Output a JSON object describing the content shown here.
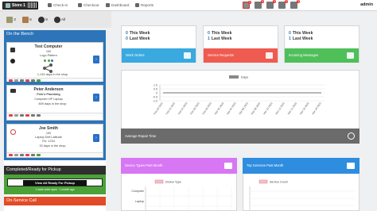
{
  "topbar": {
    "store_label": "Store 1",
    "nav": [
      {
        "label": "Check-in",
        "icon": "check-in-icon"
      },
      {
        "label": "Checkout",
        "icon": "cart-icon"
      },
      {
        "label": "Dashboard",
        "icon": "dashboard-icon"
      },
      {
        "label": "Reports",
        "icon": "reports-icon"
      }
    ],
    "icon_badges": [
      "2",
      "9",
      "4",
      "5",
      "3"
    ],
    "user": "admin"
  },
  "subbar": {
    "items": [
      {
        "icon": "tickets-icon",
        "count": "3"
      },
      {
        "icon": "users-icon",
        "count": "6"
      },
      {
        "icon": "clock-icon",
        "count": "9"
      },
      {
        "icon": "timer-icon",
        "count": "All"
      }
    ]
  },
  "bench": {
    "title": "On the Bench",
    "cards": [
      {
        "name": "Test Computer",
        "line1": "100",
        "line2": "Logo Pattern",
        "days": "1,133 days in the shop"
      },
      {
        "name": "Peter Anderson",
        "line1": "Pete's Plumbing",
        "line2": "Computer HP Laptop",
        "days": "809 days in the shop"
      },
      {
        "name": "Joe Smith",
        "line1": "100",
        "line2": "Laptop Dell Latitude",
        "line3": "Fix: 1234",
        "days": "32 days in the shop"
      }
    ]
  },
  "ready": {
    "title": "Completed/Ready for Pickup",
    "button": "View All Ready For Pickup",
    "sub": "1 work order open · 1 month ago"
  },
  "service_call": {
    "title": "On-Service Call"
  },
  "stats": [
    {
      "this_week": "0",
      "last_week": "0",
      "this_label": "This Week",
      "last_label": "Last Week"
    },
    {
      "this_week": "0",
      "last_week": "1",
      "this_label": "This Week",
      "last_label": "Last Week"
    },
    {
      "this_week": "0",
      "last_week": "1",
      "this_label": "This Week",
      "last_label": "Last Week"
    }
  ],
  "tiles": [
    {
      "label": "Work Orders",
      "color": "#39a9e0",
      "icon": "wrench-icon"
    },
    {
      "label": "Service Requests",
      "color": "#ef5b50",
      "icon": "chat-icon"
    },
    {
      "label": "Incoming Messages",
      "color": "#4fbf5a",
      "icon": "phone-icon"
    }
  ],
  "repair": {
    "label": "Average Repair Time",
    "icon": "clock-icon"
  },
  "device_types": {
    "label": "Device Types Past Month",
    "icon": "monitor-icon"
  },
  "top_services": {
    "label": "Top Services Past Month",
    "icon": "toolbox-icon"
  },
  "chart_data": [
    {
      "type": "line",
      "title": "",
      "legend": [
        "Days"
      ],
      "yticks": [
        "1.0",
        "0.5",
        "0",
        "-0.5",
        "-1.0"
      ],
      "ylim": [
        -1.0,
        1.0
      ],
      "x": [
        "Feb 20 2023",
        "Feb 22 2023",
        "Feb 24 2023",
        "Feb 26 2023",
        "Feb 28 2023",
        "Mar 02 2023",
        "Mar 04 2023",
        "Mar 06 2023",
        "Mar 08 2023",
        "Mar 10 2023",
        "Mar 12 2023",
        "Mar 14 2023",
        "Mar 16 2023",
        "Mar 18 2023"
      ],
      "series": [
        {
          "name": "Days",
          "values": [
            0,
            0,
            0,
            0,
            0,
            0,
            0,
            0,
            0,
            0,
            0,
            0,
            0,
            0
          ]
        }
      ]
    },
    {
      "type": "bar",
      "legend": [
        "Device Type"
      ],
      "categories": [
        "Computer",
        "Laptop"
      ]
    },
    {
      "type": "bar",
      "legend": [
        "Service Count"
      ],
      "categories": []
    }
  ]
}
